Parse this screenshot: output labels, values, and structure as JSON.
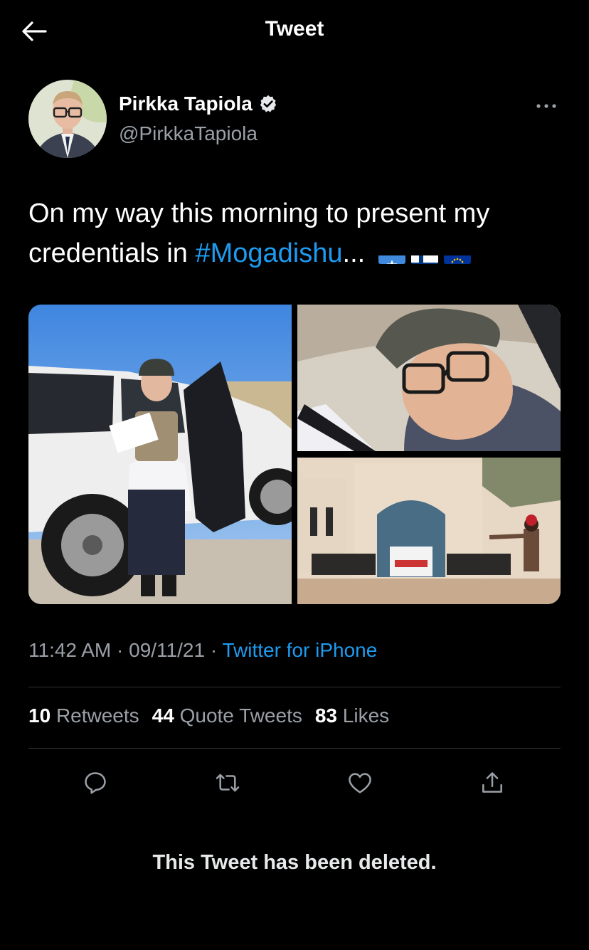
{
  "header": {
    "title": "Tweet",
    "back_icon": "arrow-left-icon"
  },
  "author": {
    "display_name": "Pirkka Tapiola",
    "handle": "@PirkkaTapiola",
    "verified": true,
    "verified_icon": "verified-badge-icon",
    "more_icon": "more-horizontal-icon"
  },
  "tweet": {
    "text_before": "On my way this morning to present my credentials in ",
    "hashtag": "#Mogadishu",
    "text_after": "...",
    "flags": [
      "somalia-flag-icon",
      "finland-flag-icon",
      "eu-flag-icon"
    ]
  },
  "media": {
    "count": 3,
    "items": [
      "photo-man-by-car",
      "photo-man-in-helmet",
      "photo-gate"
    ]
  },
  "meta": {
    "time": "11:42 AM",
    "separator": "·",
    "date": "09/11/21",
    "source": "Twitter for iPhone"
  },
  "stats": {
    "retweets": {
      "count": "10",
      "label": "Retweets"
    },
    "quotes": {
      "count": "44",
      "label": "Quote Tweets"
    },
    "likes": {
      "count": "83",
      "label": "Likes"
    }
  },
  "actions": [
    "reply-icon",
    "retweet-icon",
    "like-icon",
    "share-icon"
  ],
  "notice": {
    "text": "This Tweet has been deleted."
  },
  "colors": {
    "background": "#000000",
    "accent": "#1d9bf0",
    "muted": "#9aa0a6",
    "divider": "#2f3336"
  }
}
